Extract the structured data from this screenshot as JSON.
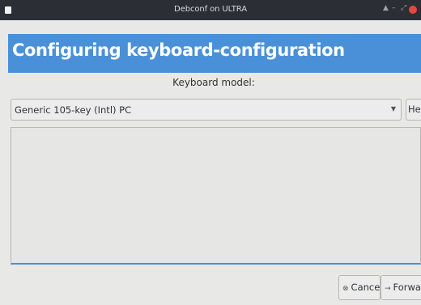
{
  "window": {
    "title": "Debconf on ULTRA",
    "controls": [
      "▲",
      "–",
      "⤢"
    ],
    "accent_color": "#4a90d9",
    "close_color": "#e5493c"
  },
  "header": {
    "title": "Configuring keyboard-configuration"
  },
  "form": {
    "label": "Keyboard model:",
    "selected_value": "Generic 105-key (Intl) PC",
    "help_label": "Help"
  },
  "buttons": {
    "cancel_label": "Cancel",
    "forward_label": "Forward"
  },
  "icons": {
    "cancel": "cancel-icon",
    "forward": "forward-arrow-icon",
    "dropdown": "chevron-down-icon"
  }
}
